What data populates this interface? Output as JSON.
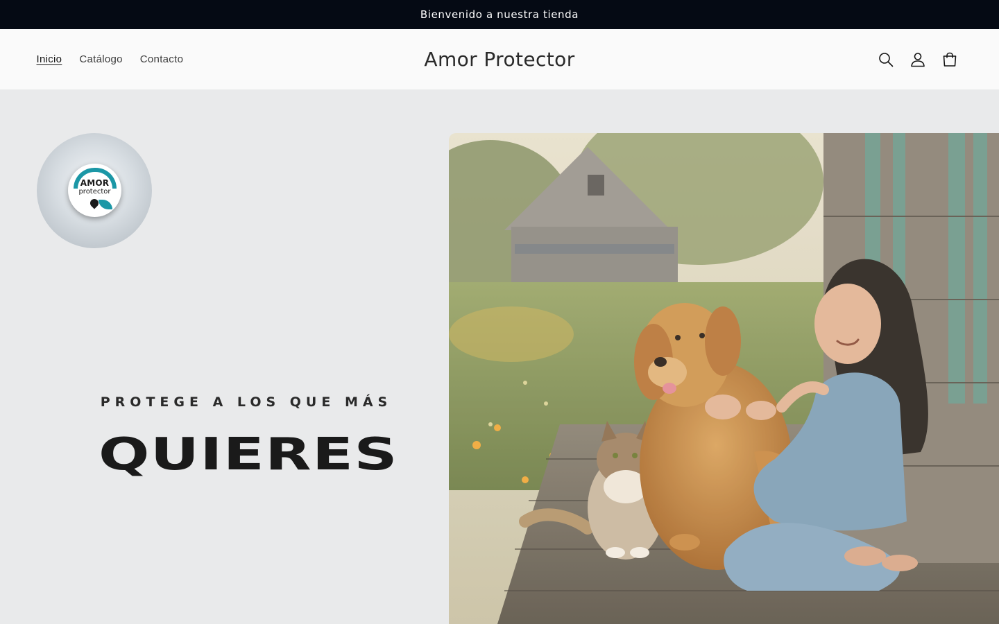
{
  "announcement": {
    "text": "Bienvenido a nuestra tienda"
  },
  "header": {
    "nav": [
      {
        "label": "Inicio",
        "active": true
      },
      {
        "label": "Catálogo",
        "active": false
      },
      {
        "label": "Contacto",
        "active": false
      }
    ],
    "brand": "Amor Protector",
    "icons": [
      "search-icon",
      "account-icon",
      "cart-icon"
    ]
  },
  "hero": {
    "logo": {
      "line1": "AMOR",
      "line2": "protector"
    },
    "tagline": "PROTEGE A LOS QUE MÁS",
    "headline": "QUIERES",
    "image": "girl-dog-cat-porch-photo"
  },
  "colors": {
    "announcement_bg": "#050a14",
    "hero_bg": "#e9eaeb",
    "logo_accent": "#1b97a6"
  }
}
